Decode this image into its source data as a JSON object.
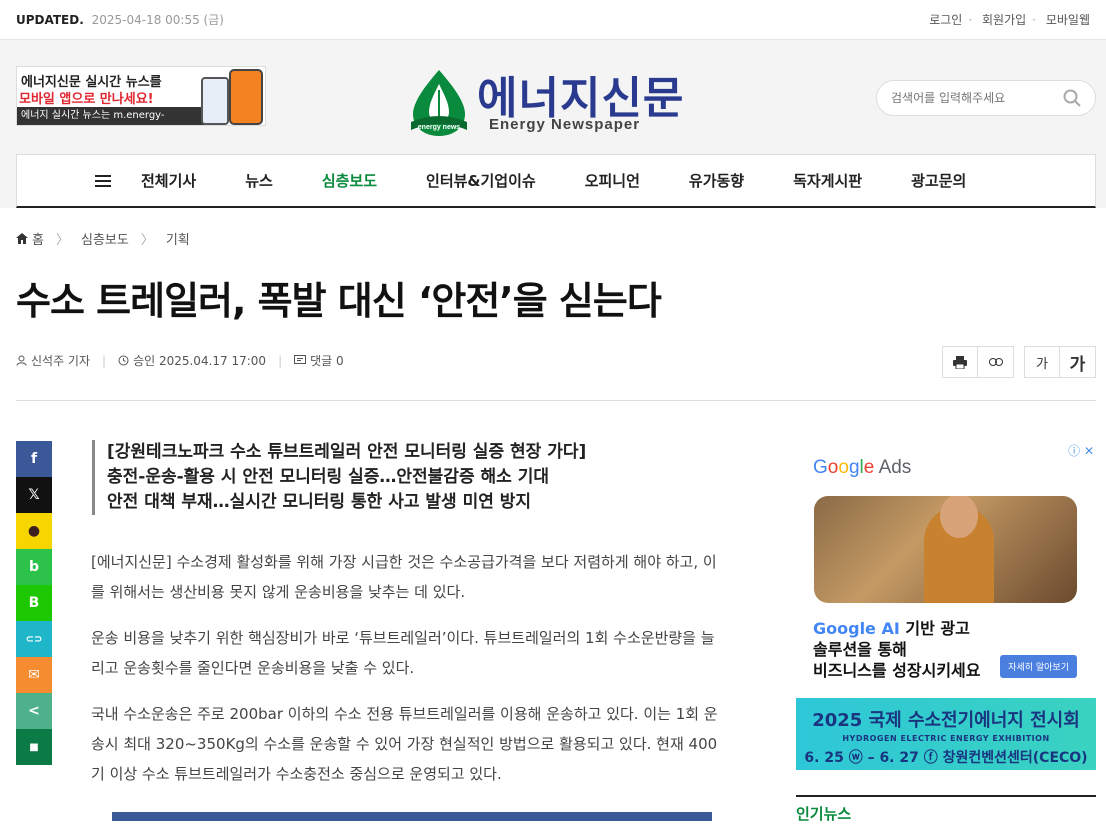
{
  "topbar": {
    "updated_label": "UPDATED.",
    "updated_time": "2025-04-18 00:55 (금)",
    "links": [
      "로그인",
      "회원가입",
      "모바일웹"
    ]
  },
  "banner": {
    "line1": "에너지신문 실시간 뉴스를",
    "line2": "모바일 앱으로 만나세요!",
    "line3": "에너지 실시간 뉴스는 m.energy-news.co.kr"
  },
  "logo": {
    "name": "에너지신문",
    "english": "Energy Newspaper",
    "badge": "energy news",
    "accent": "#2a3b8f",
    "leaf": "#0a8a3c"
  },
  "search": {
    "placeholder": "검색어를 입력해주세요"
  },
  "nav": {
    "items": [
      "전체기사",
      "뉴스",
      "심층보도",
      "인터뷰&기업이슈",
      "오피니언",
      "유가동향",
      "독자게시판",
      "광고문의"
    ],
    "active_index": 2,
    "active_color": "#0a8a3c"
  },
  "breadcrumb": [
    "홈",
    "심층보도",
    "기획"
  ],
  "article": {
    "title": "수소 트레일러, 폭발 대신 ‘안전’을 싣는다",
    "author": "신석주 기자",
    "approved": "승인 2025.04.17 17:00",
    "comments": "댓글 0",
    "summary": [
      "[강원테크노파크 수소 튜브트레일러 안전 모니터링 실증 현장 가다]",
      "충전-운송-활용 시 안전 모니터링 실증…안전불감증 해소 기대",
      "안전 대책 부재…실시간 모니터링 통한 사고 발생 미연 방지"
    ],
    "paragraphs": [
      "[에너지신문] 수소경제 활성화를 위해 가장 시급한 것은 수소공급가격을 보다 저렴하게 해야 하고, 이를 위해서는 생산비용 못지 않게 운송비용을 낮추는 데 있다.",
      "운송 비용을 낮추기 위한 핵심장비가 바로 ‘튜브트레일러’이다. 튜브트레일러의 1회 수소운반량을 늘리고 운송횟수를 줄인다면 운송비용을 낮출 수 있다.",
      "국내 수소운송은 주로 200bar 이하의 수소 전용 튜브트레일러를 이용해 운송하고 있다. 이는 1회 운송시 최대 320~350Kg의 수소를 운송할 수 있어 가장 현실적인 방법으로 활용되고 있다. 현재 400기 이상 수소 튜브트레일러가 수소충전소 중심으로 운영되고 있다."
    ]
  },
  "font_buttons": [
    "가",
    "가"
  ],
  "share": [
    {
      "name": "facebook",
      "color": "#3b5998",
      "glyph": "f"
    },
    {
      "name": "x",
      "color": "#111111",
      "glyph": "𝕏"
    },
    {
      "name": "kakaotalk",
      "color": "#f7d600",
      "glyph": "●"
    },
    {
      "name": "band",
      "color": "#2dc34a",
      "glyph": "b"
    },
    {
      "name": "blog",
      "color": "#1ec800",
      "glyph": "B"
    },
    {
      "name": "link",
      "color": "#1fb6c9",
      "glyph": "⊂⊃"
    },
    {
      "name": "email",
      "color": "#f58c2f",
      "glyph": "✉"
    },
    {
      "name": "share",
      "color": "#4fb08c",
      "glyph": "<"
    },
    {
      "name": "bookmark",
      "color": "#0b7a45",
      "glyph": "■"
    }
  ],
  "ad": {
    "brand": "Google Ads",
    "copy_ai": "Google AI",
    "copy1_rest": " 기반 광고",
    "copy2": "솔루션을 통해",
    "copy3": "비즈니스를 성장시키세요",
    "cta": "자세히 알아보기"
  },
  "expo": {
    "title": "2025 국제 수소전기에너지 전시회",
    "subtitle": "HYDROGEN ELECTRIC ENERGY EXHIBITION",
    "dates": "6. 25 ⓦ – 6. 27 ⓕ 창원컨벤션센터(CECO)"
  },
  "popular": {
    "title": "인기뉴스"
  }
}
